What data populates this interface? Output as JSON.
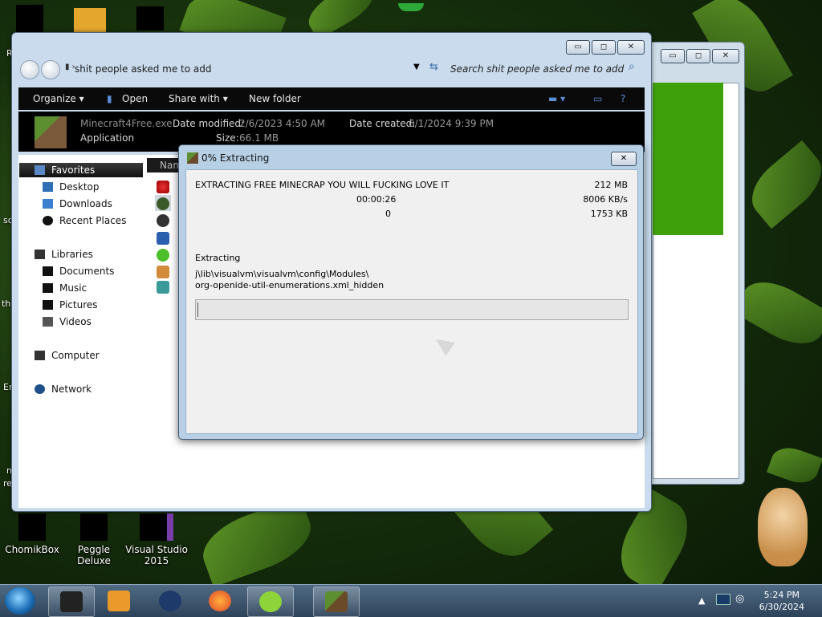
{
  "desktop": {
    "icons": [
      {
        "label": "ChomikBox"
      },
      {
        "label": "Peggle Deluxe"
      },
      {
        "label": "Visual Studio 2015"
      }
    ],
    "edge_fragments": [
      "R",
      "sc",
      "th",
      "Er",
      "n",
      "re"
    ]
  },
  "explorer": {
    "address": "shit people asked me to add",
    "search_placeholder": "Search shit people asked me to add",
    "toolbar": {
      "organize": "Organize",
      "open": "Open",
      "share_with": "Share with",
      "new_folder": "New folder"
    },
    "details": {
      "file_name": "Minecraft4Free.exe",
      "file_type": "Application",
      "date_modified_label": "Date modified:",
      "date_modified": "2/6/2023 4:50 AM",
      "date_created_label": "Date created:",
      "date_created": "6/1/2024 9:39 PM",
      "size_label": "Size:",
      "size": "66.1 MB"
    },
    "column_header_fragment": "Nam",
    "nav": {
      "favorites": "Favorites",
      "desktop": "Desktop",
      "downloads": "Downloads",
      "recent_places": "Recent Places",
      "libraries": "Libraries",
      "documents": "Documents",
      "music": "Music",
      "pictures": "Pictures",
      "videos": "Videos",
      "computer": "Computer",
      "network": "Network"
    }
  },
  "dialog": {
    "title": "0% Extracting",
    "close_label": "✕",
    "message": "EXTRACTING FREE MINECRAP YOU WILL FUCKING LOVE IT",
    "elapsed": "00:00:26",
    "remaining_files": "0",
    "total_size": "212 MB",
    "speed": "8006 KB/s",
    "processed": "1753 KB",
    "status_label": "Extracting",
    "current_path": "j\\lib\\visualvm\\visualvm\\config\\Modules\\",
    "current_file": "org-openide-util-enumerations.xml_hidden",
    "progress_percent": 0
  },
  "window_buttons": {
    "minimize": "▭",
    "maximize": "◻",
    "close": "✕"
  },
  "taskbar": {
    "clock_time": "5:24 PM",
    "clock_date": "6/30/2024"
  },
  "colors": {
    "progress": "#4fbf3a",
    "toolbar": "#0a0a0a",
    "window_frame": "#c9dbec"
  }
}
